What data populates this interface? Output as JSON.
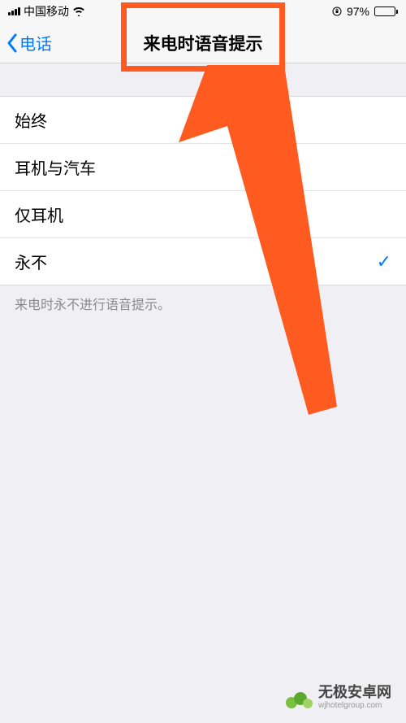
{
  "statusBar": {
    "carrier": "中国移动",
    "battery_percent": "97%"
  },
  "nav": {
    "back_label": "电话",
    "title": "来电时语音提示"
  },
  "options": [
    {
      "label": "始终",
      "selected": false
    },
    {
      "label": "耳机与汽车",
      "selected": false
    },
    {
      "label": "仅耳机",
      "selected": false
    },
    {
      "label": "永不",
      "selected": true
    }
  ],
  "footer_text": "来电时永不进行语音提示。",
  "highlight_color": "#ff5a1f",
  "accent_color": "#007aff",
  "watermark": {
    "title": "无极安卓网",
    "url": "wjhotelgroup.com"
  }
}
